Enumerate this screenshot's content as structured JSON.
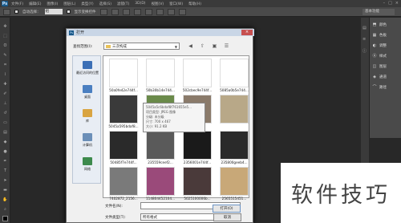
{
  "app": {
    "logo": "Ps"
  },
  "menubar": {
    "items": [
      "文件(F)",
      "编辑(E)",
      "图像(I)",
      "图层(L)",
      "类型(Y)",
      "选择(S)",
      "滤镜(T)",
      "3D(D)",
      "视图(V)",
      "窗口(W)",
      "帮助(H)"
    ]
  },
  "optionsbar": {
    "auto_select_label": "自动选择：",
    "auto_select_value": "组",
    "show_transform_label": "显示变换控件",
    "workspace": "基本功能"
  },
  "panels": {
    "items": [
      {
        "icon": "⬒",
        "label": "颜色"
      },
      {
        "icon": "▦",
        "label": "色板"
      },
      {
        "icon": "◐",
        "label": "调整"
      },
      {
        "icon": "Ⓐ",
        "label": "样式"
      },
      {
        "icon": "◫",
        "label": "图层"
      },
      {
        "icon": "◈",
        "label": "通道"
      },
      {
        "icon": "⌒",
        "label": "路径"
      }
    ]
  },
  "dialog": {
    "title": "打开",
    "look_in_label": "查找范围(I):",
    "look_in_value": "三次构成",
    "places": [
      {
        "label": "最近访问的位置",
        "icon": "recent-places-icon",
        "color": "#3b6fb6"
      },
      {
        "label": "桌面",
        "icon": "desktop-icon",
        "color": "#4a7fc1"
      },
      {
        "label": "库",
        "icon": "libraries-icon",
        "color": "#d9a441"
      },
      {
        "label": "计算机",
        "icon": "computer-icon",
        "color": "#6b8fb8"
      },
      {
        "label": "网络",
        "icon": "network-icon",
        "color": "#3d8a4d"
      }
    ],
    "files": [
      {
        "name": "50a0fe42e744f...",
        "color": "#ffffff"
      },
      {
        "name": "50b30b14e744...",
        "color": "#ffffff"
      },
      {
        "name": "502cbec9e744f...",
        "color": "#ffffff"
      },
      {
        "name": "5085a0b5e744...",
        "color": "#ffffff"
      },
      {
        "name": "5045a595bdaf8...",
        "color": "#3a3a3a"
      },
      {
        "name": "",
        "color": "#6a8a4a"
      },
      {
        "name": "",
        "color": "#8a7a6a"
      },
      {
        "name": "",
        "color": "#b8a888"
      },
      {
        "name": "50485f7e744f...",
        "color": "#2a2a2a"
      },
      {
        "name": "235559ceef2...",
        "color": "#5a5a5a"
      },
      {
        "name": "2356001e744f...",
        "color": "#1a1a1a"
      },
      {
        "name": "235800geeb4...",
        "color": "#2a2a2a"
      },
      {
        "name": "7402872_2156...",
        "color": "#7a7a7a"
      },
      {
        "name": "114804452104...",
        "color": "#9a4a7a"
      },
      {
        "name": "5025100006b...",
        "color": "#4a3a3a"
      },
      {
        "name": "2565515451...",
        "color": "#c8a878"
      }
    ],
    "tooltip": [
      "5045a5c6bdaf8f761655e5...",
      "项目类型: JPEG 图像",
      "分级: 未分级",
      "尺寸: 700 x 467",
      "大小: 91.2 KB"
    ],
    "filename_label": "文件名(N):",
    "filename_value": "",
    "filetype_label": "文件类型(T):",
    "filetype_value": "所有格式",
    "open_label": "打开(O)",
    "cancel_label": "取消"
  },
  "watermark": {
    "text": "软件技巧"
  }
}
